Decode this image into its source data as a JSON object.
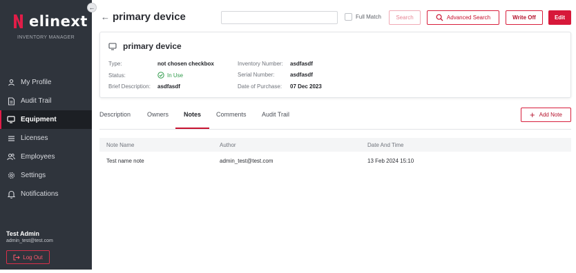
{
  "brand": {
    "name": "elinext",
    "subtitle": "INVENTORY MANAGER",
    "accent": "#d7183a"
  },
  "sidebar": {
    "collapse_icon": "arrow-left-icon",
    "items": [
      {
        "label": "My Profile",
        "icon": "user-icon"
      },
      {
        "label": "Audit Trail",
        "icon": "document-icon"
      },
      {
        "label": "Equipment",
        "icon": "monitor-icon",
        "active": true
      },
      {
        "label": "Licenses",
        "icon": "list-icon"
      },
      {
        "label": "Employees",
        "icon": "users-icon"
      },
      {
        "label": "Settings",
        "icon": "gear-icon"
      },
      {
        "label": "Notifications",
        "icon": "bell-icon"
      }
    ],
    "user": {
      "name": "Test Admin",
      "email": "admin_test@test.com"
    },
    "logout_label": "Log Out"
  },
  "header": {
    "title": "primary device",
    "search": {
      "value": "",
      "placeholder": ""
    },
    "full_match_label": "Full Match",
    "search_button": "Search",
    "advanced_search_button": "Advanced Search",
    "write_off_button": "Write Off",
    "edit_button": "Edit"
  },
  "device": {
    "title": "primary device",
    "type_label": "Type:",
    "type_value": "not chosen checkbox",
    "status_label": "Status:",
    "status_value": "In Use",
    "brief_label": "Brief Description:",
    "brief_value": "asdfasdf",
    "inventory_label": "Inventory Number:",
    "inventory_value": "asdfasdf",
    "serial_label": "Serial Number:",
    "serial_value": "asdfasdf",
    "purchase_label": "Date of Purchase:",
    "purchase_value": "07 Dec 2023"
  },
  "tabs": [
    {
      "label": "Description"
    },
    {
      "label": "Owners"
    },
    {
      "label": "Notes",
      "active": true
    },
    {
      "label": "Comments"
    },
    {
      "label": "Audit Trail"
    }
  ],
  "add_note_button": "Add Note",
  "notes_table": {
    "columns": [
      "Note Name",
      "Author",
      "Date And Time"
    ],
    "rows": [
      [
        "Test name note",
        "admin_test@test.com",
        "13 Feb 2024 15:10"
      ]
    ]
  }
}
